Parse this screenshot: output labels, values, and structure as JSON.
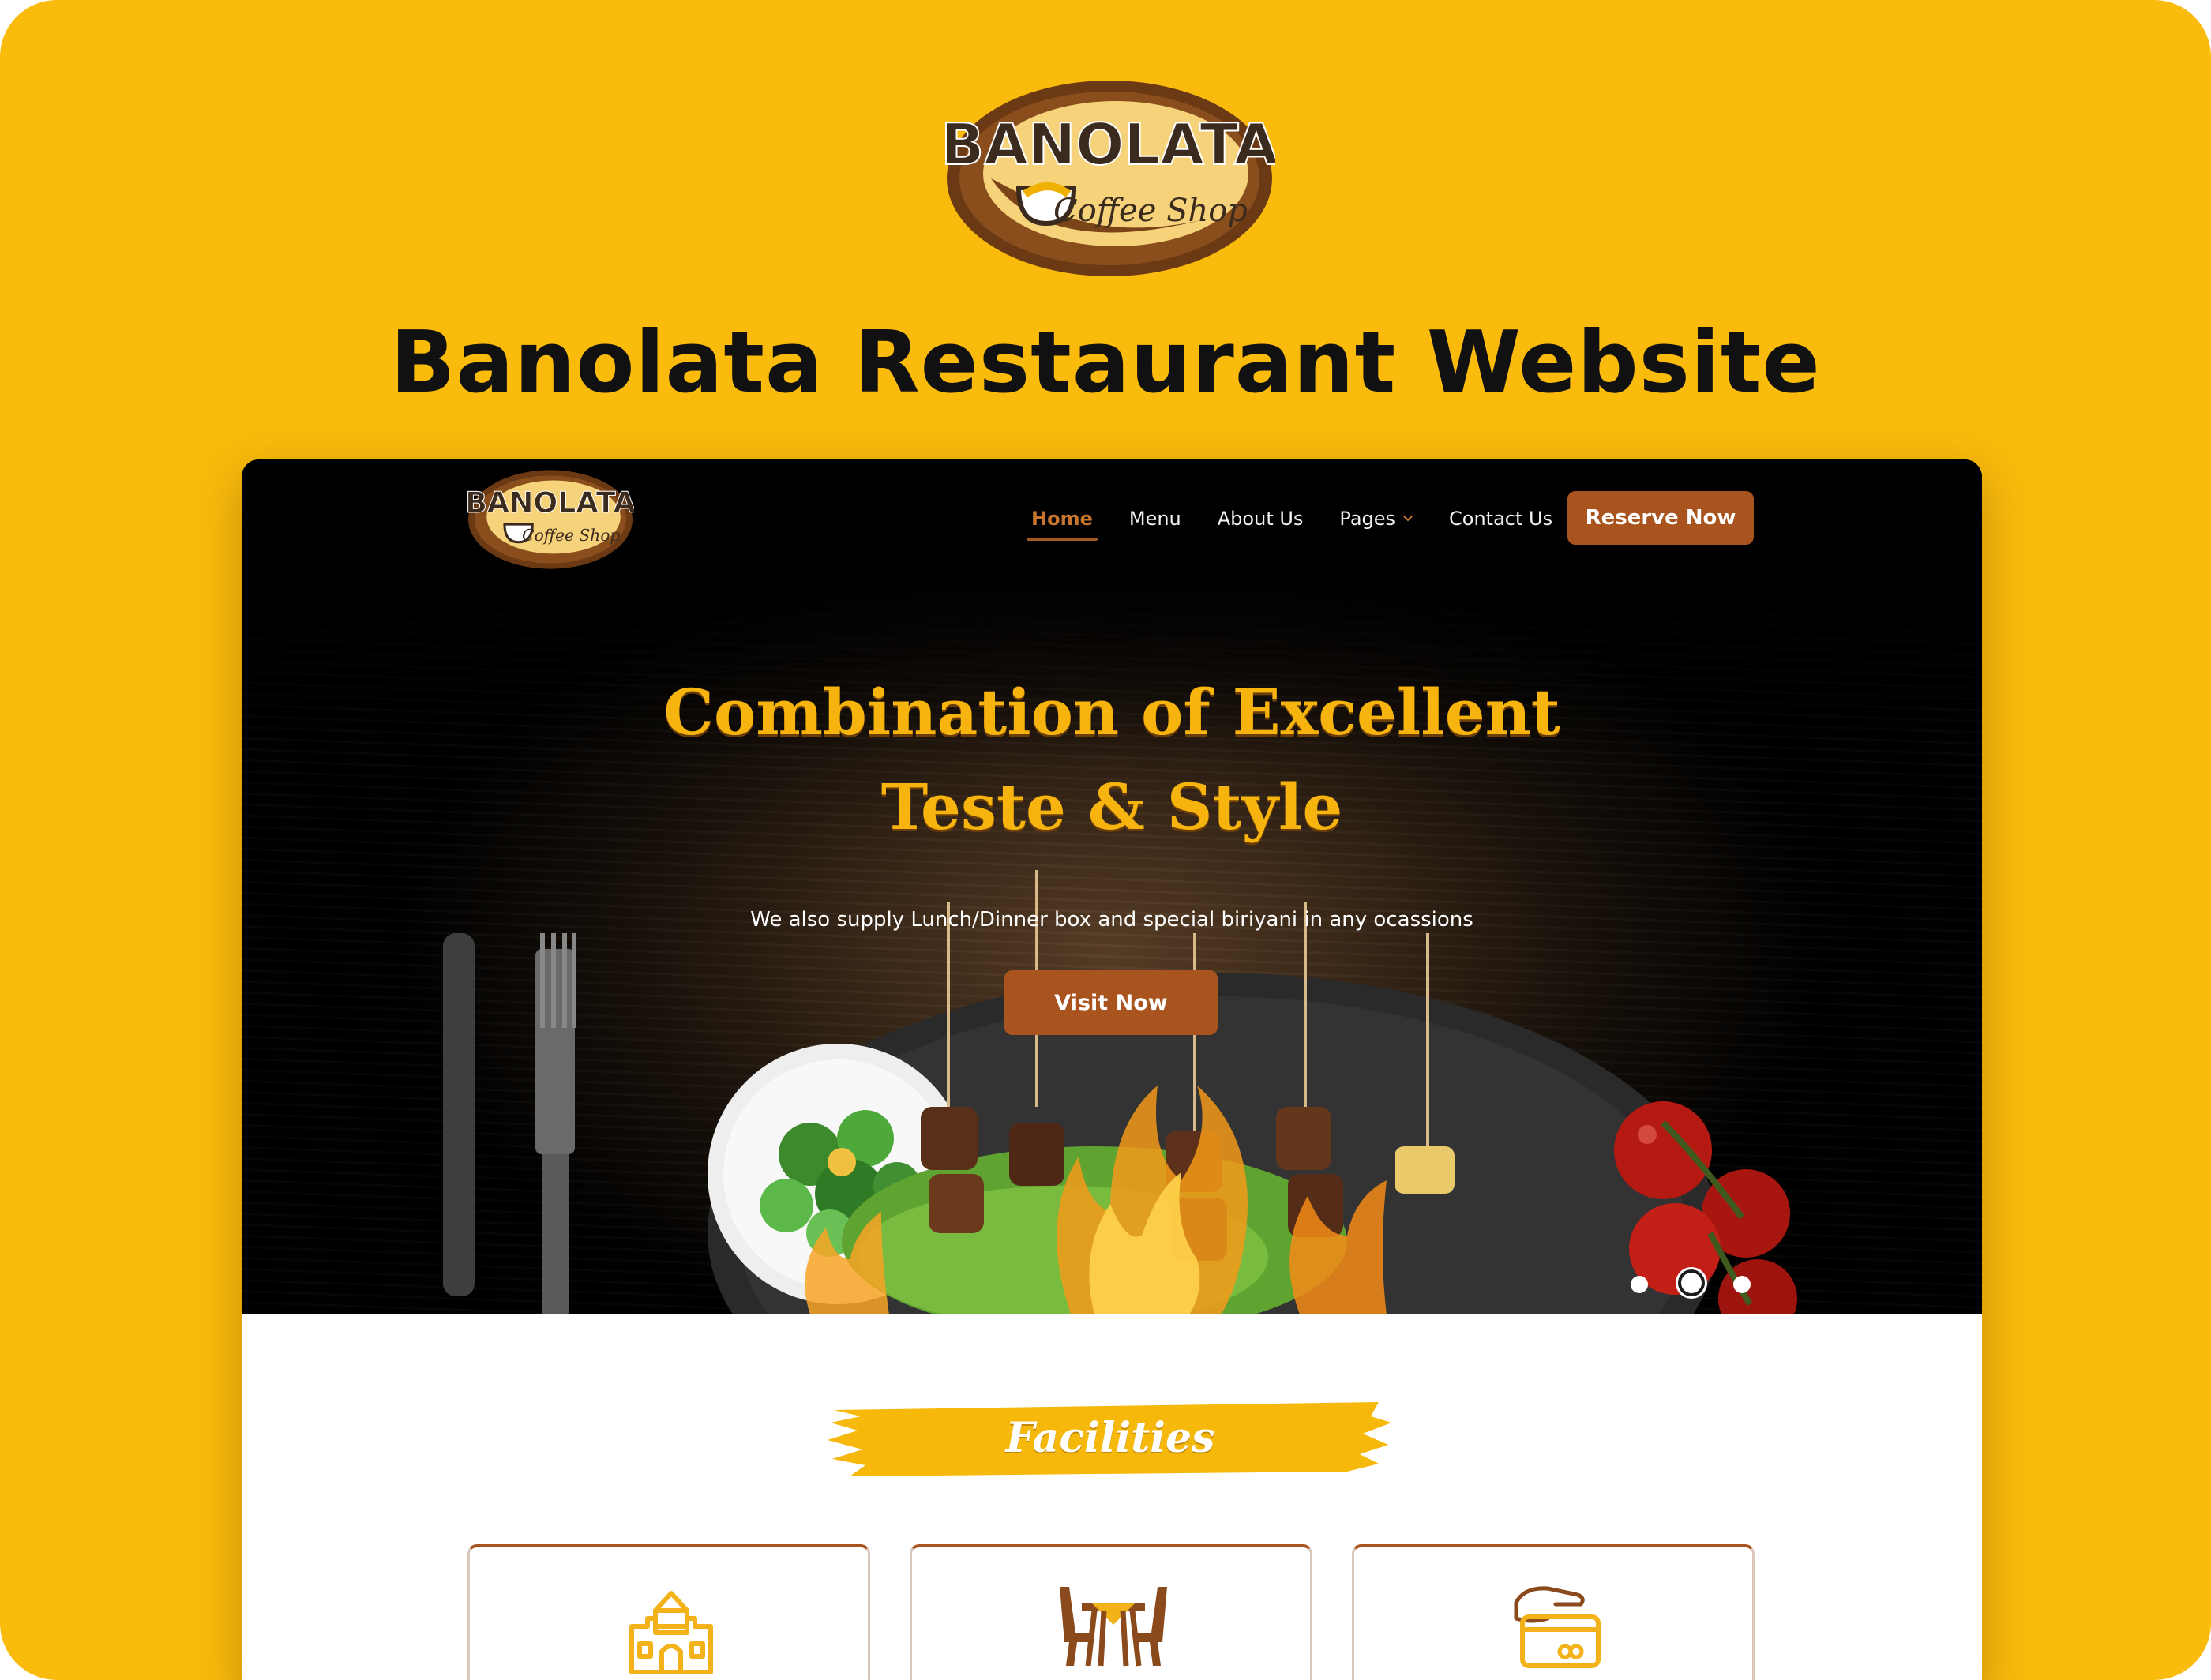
{
  "page_heading": "Banolata Restaurant Website",
  "logo": {
    "brand": "BANOLATA",
    "tagline": "Coffee Shop"
  },
  "nav": {
    "items": [
      {
        "label": "Home",
        "active": true
      },
      {
        "label": "Menu"
      },
      {
        "label": "About Us"
      },
      {
        "label": "Pages",
        "dropdown": true
      },
      {
        "label": "Contact Us"
      }
    ],
    "reserve_label": "Reserve Now"
  },
  "hero": {
    "title_line1": "Combination of Excellent",
    "title_line2": "Teste & Style",
    "subtitle": "We also supply Lunch/Dinner box and special biriyani in any ocassions",
    "cta_label": "Visit Now",
    "slides": 3,
    "active_slide": 2
  },
  "facilities": {
    "title": "Facilities",
    "cards": [
      {
        "icon": "castle-icon"
      },
      {
        "icon": "dining-table-icon"
      },
      {
        "icon": "card-payment-icon"
      }
    ]
  },
  "colors": {
    "background": "#FABB0C",
    "accent_brown": "#A9541E",
    "hero_title": "#F7B40E"
  }
}
